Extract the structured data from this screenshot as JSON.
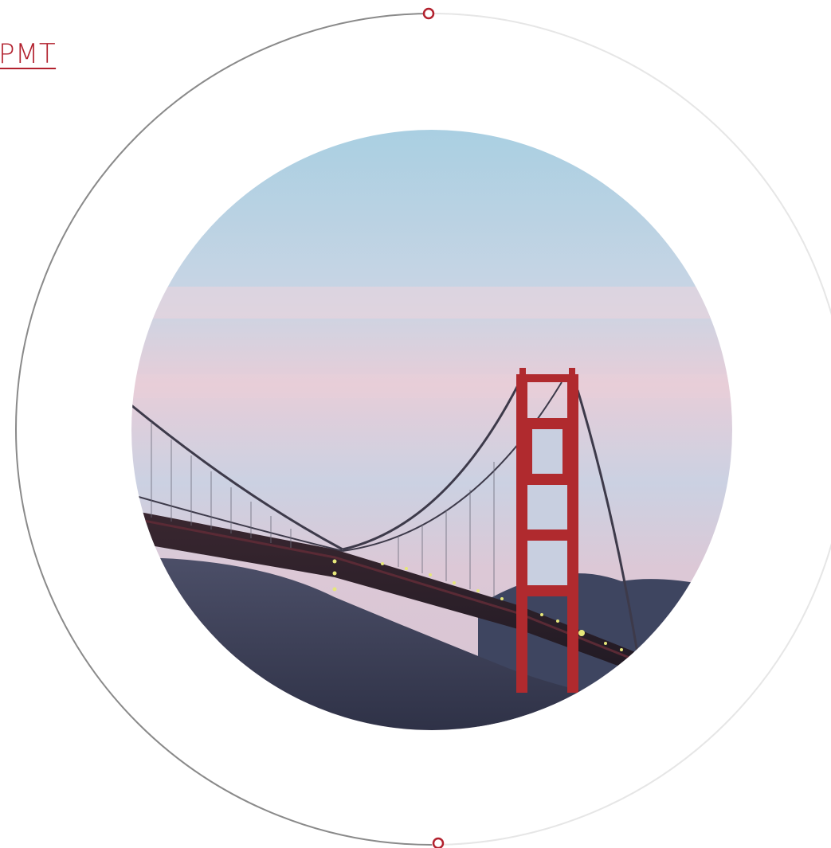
{
  "header": {
    "link_text": "PMT"
  },
  "colors": {
    "accent": "#b2212e",
    "ring_dark": "#8a8a8a",
    "ring_light": "#e6e6e6"
  },
  "icons": {
    "top_handle": "ring-dot-icon",
    "bottom_handle": "ring-dot-icon"
  }
}
